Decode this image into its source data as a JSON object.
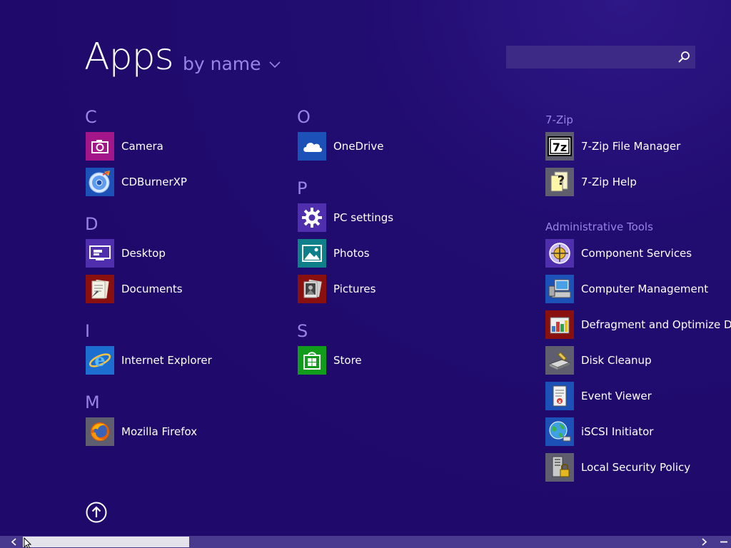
{
  "header": {
    "title": "Apps",
    "sort_label": "by name"
  },
  "search": {
    "value": "",
    "placeholder": ""
  },
  "columns": {
    "c1": {
      "letter_c": "C",
      "camera": "Camera",
      "cdburner": "CDBurnerXP",
      "letter_d": "D",
      "desktop": "Desktop",
      "documents": "Documents",
      "letter_i": "I",
      "ie": "Internet Explorer",
      "letter_m": "M",
      "firefox": "Mozilla Firefox"
    },
    "c2": {
      "letter_o": "O",
      "onedrive": "OneDrive",
      "letter_p": "P",
      "pc_settings": "PC settings",
      "photos": "Photos",
      "pictures": "Pictures",
      "letter_s": "S",
      "store": "Store"
    },
    "c3": {
      "group_7zip": "7-Zip",
      "fm7zip": "7-Zip File Manager",
      "help7zip": "7-Zip Help",
      "group_admin": "Administrative Tools",
      "component_services": "Component Services",
      "computer_management": "Computer Management",
      "defrag": "Defragment and Optimize Drives",
      "disk_cleanup": "Disk Cleanup",
      "event_viewer": "Event Viewer",
      "iscsi": "iSCSI Initiator",
      "local_security": "Local Security Policy"
    }
  },
  "colors": {
    "background": "#1f0a6b",
    "accent_text": "#9a83e6",
    "tile_magenta": "#a2168a",
    "tile_blue": "#1c52b8",
    "tile_purple": "#4f2fae",
    "tile_red": "#8a1010",
    "tile_teal": "#0f7f8a",
    "tile_green": "#119c1b",
    "tile_grey": "#5e5e6e"
  },
  "icons": {
    "camera": "camera-icon",
    "cdburner": "disc-burn-icon",
    "desktop": "desktop-icon",
    "documents": "documents-icon",
    "ie": "internet-explorer-icon",
    "firefox": "firefox-icon",
    "onedrive": "cloud-icon",
    "pc_settings": "gear-icon",
    "photos": "photos-icon",
    "pictures": "pictures-icon",
    "store": "store-bag-icon",
    "fm7zip": "7zip-icon",
    "help7zip": "help-file-icon",
    "search": "search-icon",
    "sort": "chevron-down-icon",
    "up": "up-arrow-circle-icon"
  }
}
